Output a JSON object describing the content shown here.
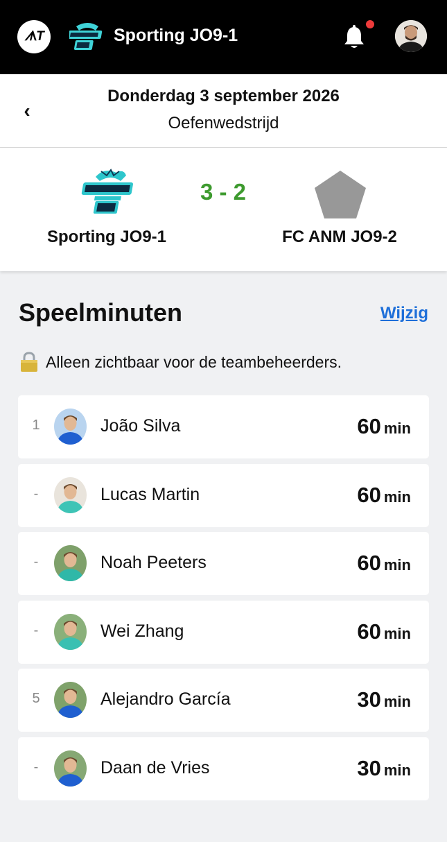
{
  "app": {
    "logo_text": "ᗑT",
    "team_title": "Sporting JO9-1"
  },
  "header": {
    "back": "‹",
    "date": "Donderdag 3 september 2026",
    "match_type": "Oefenwedstrijd"
  },
  "match": {
    "home_team": "Sporting JO9-1",
    "away_team": "FC ANM JO9-2",
    "score": "3 - 2"
  },
  "section": {
    "title": "Speelminuten",
    "edit_label": "Wijzig",
    "notice": "Alleen zichtbaar voor de teambeheerders."
  },
  "players": [
    {
      "rank": "1",
      "name": "João Silva",
      "minutes": "60",
      "unit": "min",
      "jersey": "#1f5fd0",
      "bg": "#b9d4ef"
    },
    {
      "rank": "-",
      "name": "Lucas Martin",
      "minutes": "60",
      "unit": "min",
      "jersey": "#3ec4b6",
      "bg": "#e9e4dc"
    },
    {
      "rank": "-",
      "name": "Noah Peeters",
      "minutes": "60",
      "unit": "min",
      "jersey": "#2fb8a8",
      "bg": "#7ea06a"
    },
    {
      "rank": "-",
      "name": "Wei Zhang",
      "minutes": "60",
      "unit": "min",
      "jersey": "#39c0b2",
      "bg": "#8ab07a"
    },
    {
      "rank": "5",
      "name": "Alejandro García",
      "minutes": "30",
      "unit": "min",
      "jersey": "#1f5fd0",
      "bg": "#7fa26a"
    },
    {
      "rank": "-",
      "name": "Daan de Vries",
      "minutes": "30",
      "unit": "min",
      "jersey": "#1f5fd0",
      "bg": "#86a874"
    }
  ],
  "colors": {
    "score": "#3d9a2e",
    "link": "#1e6fd9",
    "notification_dot": "#ee3b3b",
    "topbar": "#000000"
  },
  "icons": [
    "app-logo-icon",
    "team-logo-icon",
    "bell-icon",
    "user-avatar",
    "back-chevron-icon",
    "lock-icon",
    "away-team-shield-icon"
  ]
}
